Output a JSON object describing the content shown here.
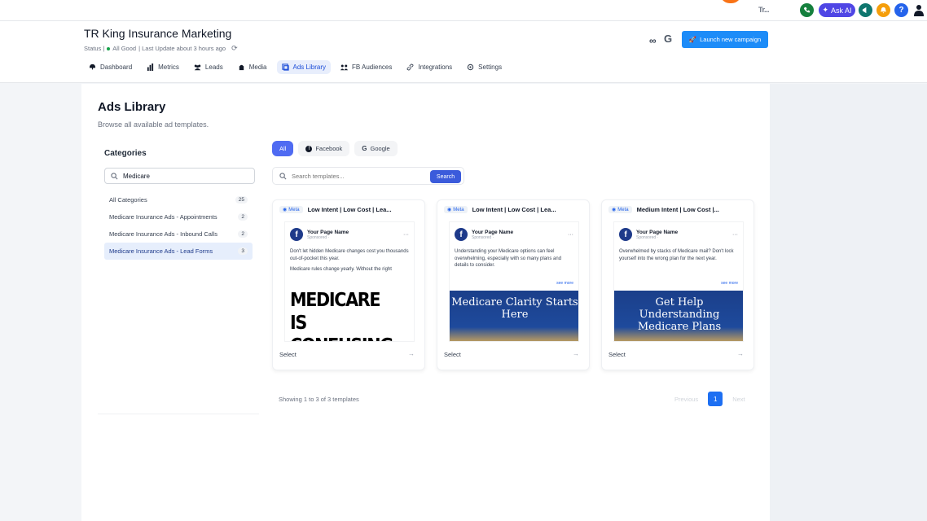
{
  "topbar": {
    "brand_short": "Tr...",
    "ask_ai_label": "Ask AI",
    "help_label": "?"
  },
  "header": {
    "company": "TR King Insurance Marketing",
    "status_label": "Status |",
    "status_value": "All Good",
    "last_update": "| Last Update about 3 hours ago",
    "launch_label": "Launch new campaign"
  },
  "nav": [
    {
      "label": "Dashboard",
      "icon": "dashboard-icon"
    },
    {
      "label": "Metrics",
      "icon": "bar-chart-icon"
    },
    {
      "label": "Leads",
      "icon": "users-icon"
    },
    {
      "label": "Media",
      "icon": "media-icon"
    },
    {
      "label": "Ads Library",
      "icon": "library-icon",
      "active": true
    },
    {
      "label": "FB Audiences",
      "icon": "audience-icon"
    },
    {
      "label": "Integrations",
      "icon": "link-icon"
    },
    {
      "label": "Settings",
      "icon": "gear-icon"
    }
  ],
  "page": {
    "title": "Ads Library",
    "subtitle": "Browse all available ad templates."
  },
  "categories": {
    "title": "Categories",
    "search_value": "Medicare",
    "items": [
      {
        "label": "All Categories",
        "count": "25"
      },
      {
        "label": "Medicare Insurance Ads - Appointments",
        "count": "2"
      },
      {
        "label": "Medicare Insurance Ads - Inbound Calls",
        "count": "2"
      },
      {
        "label": "Medicare Insurance Ads - Lead Forms",
        "count": "3",
        "active": true
      }
    ]
  },
  "filters": {
    "all": "All",
    "facebook": "Facebook",
    "google": "Google",
    "search_placeholder": "Search templates...",
    "search_button": "Search"
  },
  "cards": [
    {
      "badge": "Meta",
      "title": "Low Intent | Low Cost | Lea...",
      "page_name": "Your Page Name",
      "sponsored": "Sponsored ·",
      "text1": "Don't let hidden Medicare changes cost you thousands out-of-pocket this year.",
      "text2": "Medicare rules change yearly. Without the right",
      "see_more": "see more",
      "image_text": "MEDICARE IS CONFUSING.",
      "select": "Select"
    },
    {
      "badge": "Meta",
      "title": "Low Intent | Low Cost | Lea...",
      "page_name": "Your Page Name",
      "sponsored": "Sponsored ·",
      "text1": "Understanding your Medicare options can feel overwhelming, especially with so many plans and details to consider.",
      "text2": "",
      "see_more": "see more",
      "image_text": "Medicare Clarity Starts Here",
      "select": "Select"
    },
    {
      "badge": "Meta",
      "title": "Medium Intent | Low Cost |...",
      "page_name": "Your Page Name",
      "sponsored": "Sponsored ·",
      "text1": "Overwhelmed by stacks of Medicare mail? Don't lock yourself into the wrong plan for the next year.",
      "text2": "",
      "see_more": "see more",
      "image_text": "Get Help Understanding Medicare Plans",
      "select": "Select"
    }
  ],
  "footer": {
    "showing": "Showing 1 to 3 of 3 templates",
    "previous": "Previous",
    "page": "1",
    "next": "Next"
  },
  "colors": {
    "primary": "#1d8cf8",
    "chip_active": "#4f6bf2",
    "status_green": "#16a34a"
  }
}
